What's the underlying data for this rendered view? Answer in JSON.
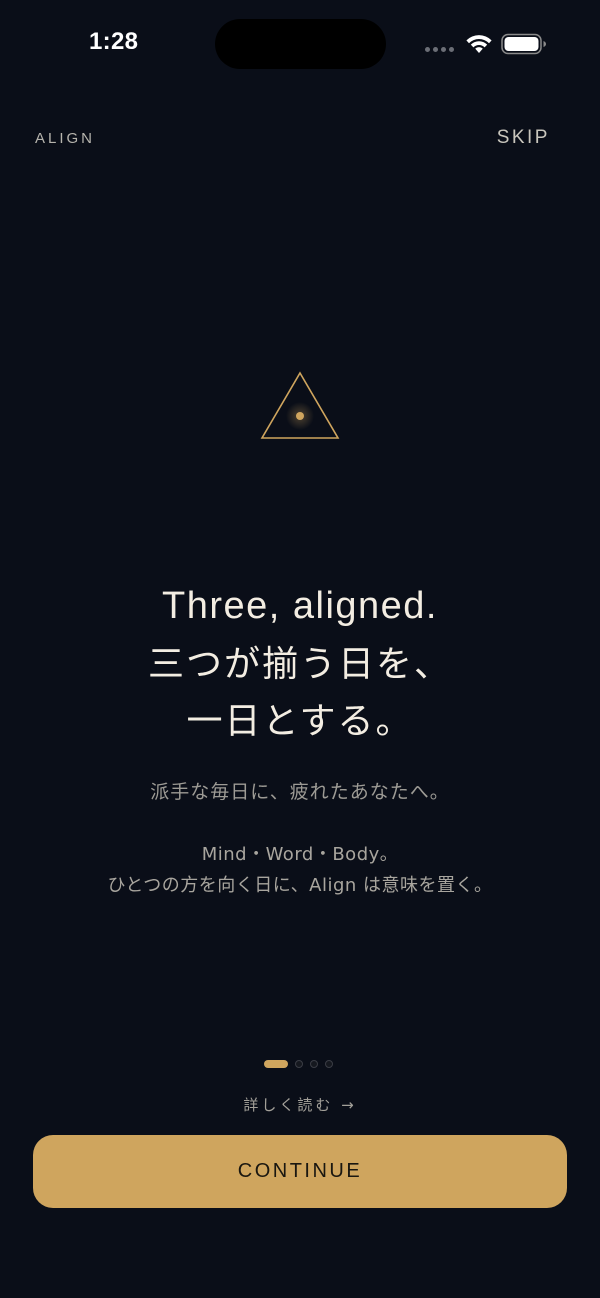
{
  "status_bar": {
    "time": "1:28",
    "signal_icon": "cellular-signal-icon",
    "wifi_icon": "wifi-icon",
    "battery_icon": "battery-icon"
  },
  "nav": {
    "brand": "ALIGN",
    "skip_label": "SKIP"
  },
  "emblem": {
    "icon": "triangle-dot-icon"
  },
  "headline": {
    "line1": "Three, aligned.",
    "line2": "三つが揃う日を、",
    "line3": "一日とする。"
  },
  "subtitle": "派手な毎日に、疲れたあなたへ。",
  "body": {
    "line1": "Mind・Word・Body。",
    "line2": "ひとつの方を向く日に、Align は意味を置く。"
  },
  "pagination": {
    "current": 1,
    "total": 4
  },
  "read_more": "詳しく読む →",
  "continue_label": "CONTINUE",
  "colors": {
    "background": "#0a0e18",
    "accent": "#cfa55e",
    "text_primary": "#f3ede2",
    "text_secondary": "#a8a59e"
  }
}
